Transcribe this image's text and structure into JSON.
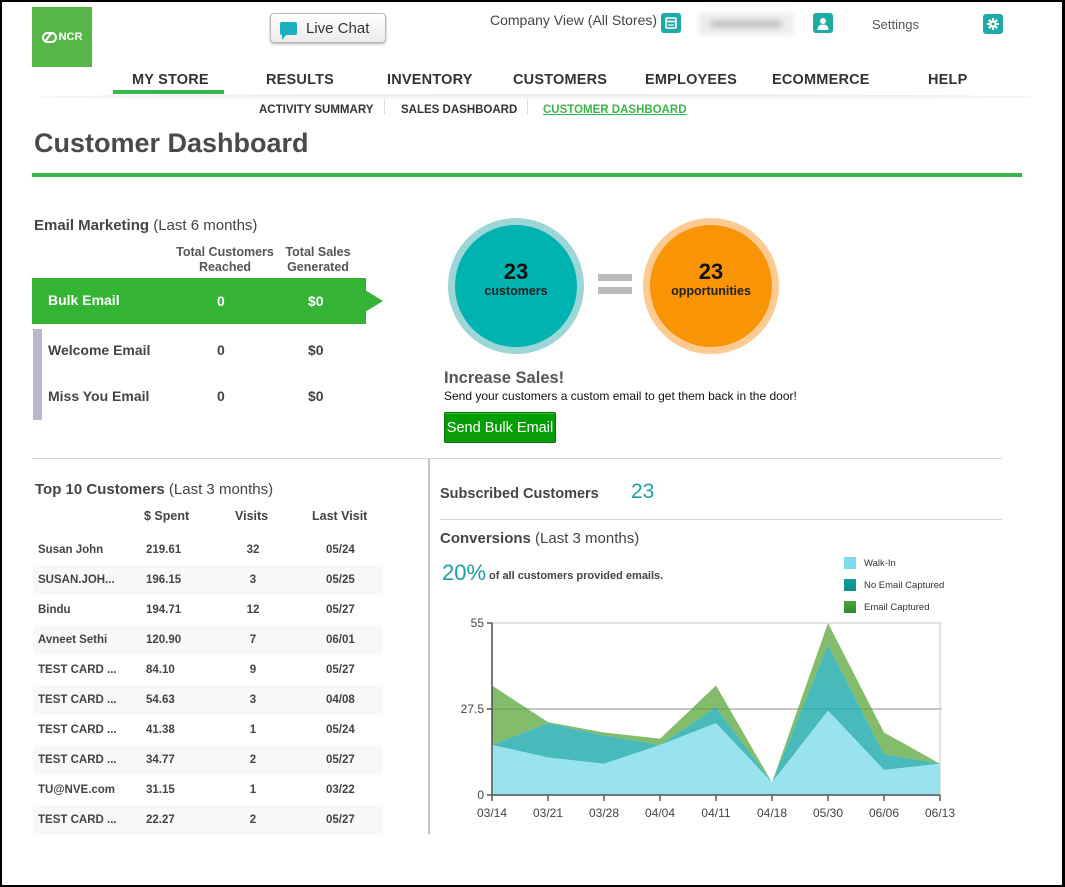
{
  "header": {
    "logo_text": "NCR",
    "live_chat_label": "Live Chat",
    "company_view": "Company View (All Stores)",
    "settings_label": "Settings",
    "icons": {
      "store": "store-icon",
      "user": "user-icon",
      "settings": "gear-icon",
      "chat": "chat-bubble-icon"
    }
  },
  "nav": {
    "items": [
      {
        "label": "MY STORE",
        "active": true
      },
      {
        "label": "RESULTS"
      },
      {
        "label": "INVENTORY"
      },
      {
        "label": "CUSTOMERS"
      },
      {
        "label": "EMPLOYEES"
      },
      {
        "label": "ECOMMERCE"
      },
      {
        "label": "HELP"
      }
    ],
    "subitems": [
      {
        "label": "ACTIVITY SUMMARY"
      },
      {
        "label": "SALES DASHBOARD"
      },
      {
        "label": "CUSTOMER DASHBOARD",
        "active": true
      }
    ]
  },
  "page": {
    "title": "Customer Dashboard"
  },
  "email_marketing": {
    "title": "Email Marketing",
    "period": "(Last 6 months)",
    "col_reached": "Total Customers Reached",
    "col_reached_l1": "Total Customers",
    "col_reached_l2": "Reached",
    "col_sales_l1": "Total Sales",
    "col_sales_l2": "Generated",
    "rows": [
      {
        "name": "Bulk Email",
        "reached": "0",
        "sales": "$0",
        "selected": true
      },
      {
        "name": "Welcome Email",
        "reached": "0",
        "sales": "$0"
      },
      {
        "name": "Miss You Email",
        "reached": "0",
        "sales": "$0"
      }
    ]
  },
  "summary": {
    "customers_count": "23",
    "customers_label": "customers",
    "opportunities_count": "23",
    "opportunities_label": "opportunities",
    "increase_title": "Increase Sales!",
    "increase_text": "Send your customers a custom email to get them back in the door!",
    "send_button": "Send Bulk Email"
  },
  "top_customers": {
    "title": "Top 10 Customers",
    "period": "(Last 3 months)",
    "columns": [
      "$ Spent",
      "Visits",
      "Last Visit"
    ],
    "rows": [
      {
        "name": "Susan John",
        "spent": "219.61",
        "visits": "32",
        "last": "05/24"
      },
      {
        "name": "SUSAN.JOH...",
        "spent": "196.15",
        "visits": "3",
        "last": "05/25"
      },
      {
        "name": "Bindu",
        "spent": "194.71",
        "visits": "12",
        "last": "05/27"
      },
      {
        "name": "Avneet Sethi",
        "spent": "120.90",
        "visits": "7",
        "last": "06/01"
      },
      {
        "name": "TEST CARD ...",
        "spent": "84.10",
        "visits": "9",
        "last": "05/27"
      },
      {
        "name": "TEST CARD ...",
        "spent": "54.63",
        "visits": "3",
        "last": "04/08"
      },
      {
        "name": "TEST CARD ...",
        "spent": "41.38",
        "visits": "1",
        "last": "05/24"
      },
      {
        "name": "TEST CARD ...",
        "spent": "34.77",
        "visits": "2",
        "last": "05/27"
      },
      {
        "name": "TU@NVE.com",
        "spent": "31.15",
        "visits": "1",
        "last": "03/22"
      },
      {
        "name": "TEST CARD ...",
        "spent": "22.27",
        "visits": "2",
        "last": "05/27"
      }
    ]
  },
  "subscribed": {
    "label": "Subscribed Customers",
    "count": "23"
  },
  "conversions": {
    "title": "Conversions",
    "period": "(Last 3 months)",
    "percent": "20%",
    "percent_text": "of all customers provided emails."
  },
  "chart_data": {
    "type": "area",
    "stacked": true,
    "title": "",
    "xlabel": "",
    "ylabel": "",
    "categories": [
      "03/14",
      "03/21",
      "03/28",
      "04/04",
      "04/11",
      "04/18",
      "05/30",
      "06/06",
      "06/13"
    ],
    "yticks": [
      "0",
      "27.5",
      "55"
    ],
    "ylim": [
      0,
      55
    ],
    "grid": true,
    "legend_position": "top-right",
    "series": [
      {
        "name": "Walk-In",
        "color": "#7fdcec",
        "values": [
          16,
          12,
          10,
          16,
          23,
          4,
          27,
          8,
          10
        ]
      },
      {
        "name": "No Email Captured",
        "color": "#1aa9aa",
        "values": [
          0,
          11,
          9,
          0,
          5,
          0,
          21,
          5,
          0
        ]
      },
      {
        "name": "Email Captured",
        "color": "#5aa63a",
        "values": [
          19,
          0.3,
          1,
          2,
          7,
          0,
          7,
          7,
          0
        ]
      }
    ]
  },
  "colors": {
    "brand_green": "#3ab54a",
    "bulk_green": "#35b335",
    "teal": "#00b3b0",
    "orange": "#f99406",
    "accent_teal_text": "#1aa1a1"
  }
}
